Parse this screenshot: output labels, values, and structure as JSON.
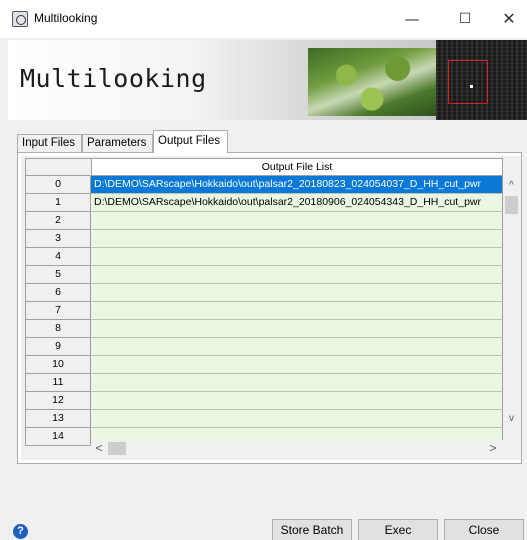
{
  "window": {
    "title": "Multilooking",
    "minimize_glyph": "—",
    "maximize_glyph": "☐",
    "close_glyph": "✕"
  },
  "banner": {
    "title": "Multilooking"
  },
  "tabs": [
    {
      "label": "Input Files",
      "active": false
    },
    {
      "label": "Parameters",
      "active": false
    },
    {
      "label": "Output Files",
      "active": true
    }
  ],
  "grid": {
    "column_header": "Output File List",
    "rows": [
      {
        "num": "0",
        "value": "D:\\DEMO\\SARscape\\Hokkaido\\out\\palsar2_20180823_024054037_D_HH_cut_pwr",
        "selected": true
      },
      {
        "num": "1",
        "value": "D:\\DEMO\\SARscape\\Hokkaido\\out\\palsar2_20180906_024054343_D_HH_cut_pwr",
        "selected": false
      },
      {
        "num": "2",
        "value": "",
        "selected": false
      },
      {
        "num": "3",
        "value": "",
        "selected": false
      },
      {
        "num": "4",
        "value": "",
        "selected": false
      },
      {
        "num": "5",
        "value": "",
        "selected": false
      },
      {
        "num": "6",
        "value": "",
        "selected": false
      },
      {
        "num": "7",
        "value": "",
        "selected": false
      },
      {
        "num": "8",
        "value": "",
        "selected": false
      },
      {
        "num": "9",
        "value": "",
        "selected": false
      },
      {
        "num": "10",
        "value": "",
        "selected": false
      },
      {
        "num": "11",
        "value": "",
        "selected": false
      },
      {
        "num": "12",
        "value": "",
        "selected": false
      },
      {
        "num": "13",
        "value": "",
        "selected": false
      },
      {
        "num": "14",
        "value": "",
        "selected": false
      }
    ]
  },
  "scroll": {
    "up_glyph": "^",
    "down_glyph": "v",
    "left_glyph": "<",
    "right_glyph": ">"
  },
  "footer": {
    "help_glyph": "?",
    "store_batch": "Store Batch",
    "exec": "Exec",
    "close": "Close"
  },
  "colors": {
    "selection": "#0a78d7",
    "row_bg": "#eaf7e2",
    "help_icon": "#1f5fbf"
  }
}
